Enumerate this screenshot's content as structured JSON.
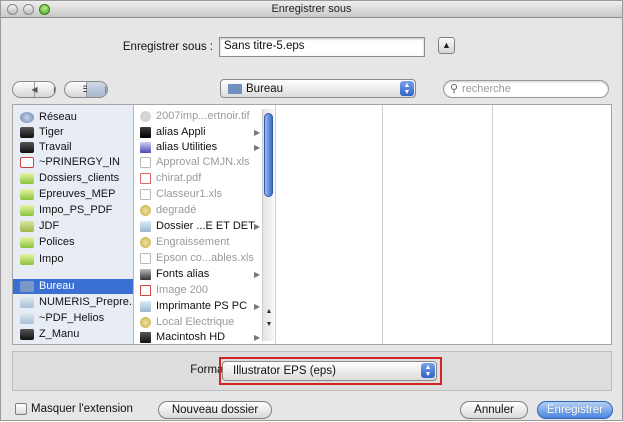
{
  "window": {
    "title": "Enregistrer sous"
  },
  "save_as": {
    "label": "Enregistrer sous :",
    "value": "Sans titre-5.eps"
  },
  "toolbar": {
    "location": "Bureau",
    "search_placeholder": "recherche"
  },
  "sidebar": {
    "items": [
      {
        "label": "Réseau",
        "icon": "network-icon"
      },
      {
        "label": "Tiger",
        "icon": "hard-drive-icon"
      },
      {
        "label": "Travail",
        "icon": "hard-drive-icon"
      },
      {
        "label": "~PRINERGY_IN",
        "icon": "document-icon"
      },
      {
        "label": "Dossiers_clients",
        "icon": "folder-icon"
      },
      {
        "label": "Epreuves_MEP",
        "icon": "folder-icon"
      },
      {
        "label": "Impo_PS_PDF",
        "icon": "folder-icon"
      },
      {
        "label": "JDF",
        "icon": "folder-icon"
      },
      {
        "label": "Polices",
        "icon": "folder-icon"
      },
      {
        "label": "Impo",
        "icon": "folder-icon"
      },
      {
        "label": "Bureau",
        "icon": "desktop-icon",
        "selected": true
      },
      {
        "label": "NUMERIS_Prepre...",
        "icon": "folder-icon"
      },
      {
        "label": "~PDF_Helios",
        "icon": "folder-icon"
      },
      {
        "label": "Z_Manu",
        "icon": "hard-drive-icon"
      }
    ]
  },
  "files": [
    {
      "label": "2007imp...ertnoir.tif",
      "dim": true,
      "icon": "image-file-icon"
    },
    {
      "label": "alias Appli",
      "dim": false,
      "icon": "alias-icon",
      "arrow": true
    },
    {
      "label": "alias Utilities",
      "dim": false,
      "icon": "alias-icon",
      "arrow": true
    },
    {
      "label": "Approval CMJN.xls",
      "dim": true,
      "icon": "spreadsheet-icon"
    },
    {
      "label": "chirat.pdf",
      "dim": true,
      "icon": "pdf-icon"
    },
    {
      "label": "Classeur1.xls",
      "dim": true,
      "icon": "spreadsheet-icon"
    },
    {
      "label": "degradé",
      "dim": true,
      "icon": "gradient-file-icon"
    },
    {
      "label": "Dossier ...E ET DET",
      "dim": false,
      "icon": "folder-icon",
      "arrow": true
    },
    {
      "label": "Engraissement",
      "dim": true,
      "icon": "gradient-file-icon"
    },
    {
      "label": "Epson co...ables.xls",
      "dim": true,
      "icon": "spreadsheet-icon"
    },
    {
      "label": "Fonts alias",
      "dim": false,
      "icon": "alias-icon",
      "arrow": true
    },
    {
      "label": "Image 200",
      "dim": true,
      "icon": "pdf-icon"
    },
    {
      "label": "Imprimante PS PC",
      "dim": false,
      "icon": "folder-icon",
      "arrow": true
    },
    {
      "label": "Local Electrique",
      "dim": true,
      "icon": "gradient-file-icon"
    },
    {
      "label": "Macintosh HD",
      "dim": false,
      "icon": "hard-drive-icon",
      "arrow": true
    }
  ],
  "format": {
    "label": "Format :",
    "value": "Illustrator EPS (eps)"
  },
  "bottom": {
    "hide_extension": "Masquer l'extension",
    "new_folder": "Nouveau dossier",
    "cancel": "Annuler",
    "save": "Enregistrer"
  }
}
